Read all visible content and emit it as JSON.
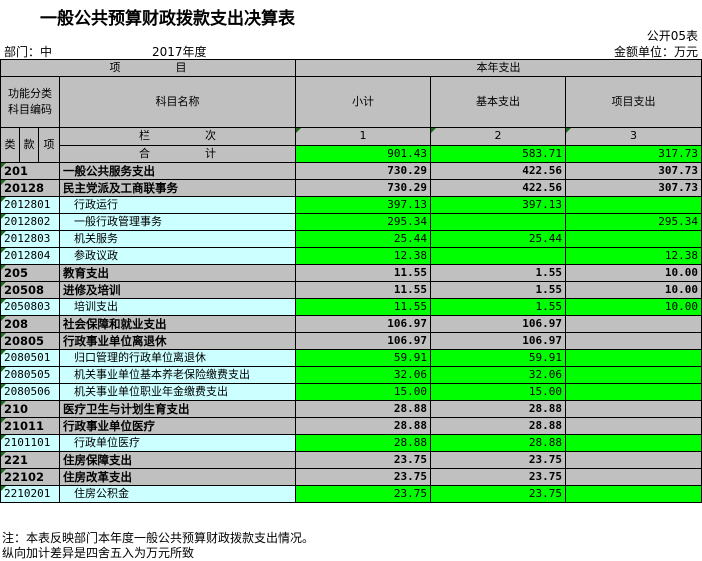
{
  "title": "一般公共预算财政拨款支出决算表",
  "form_no": "公开05表",
  "department_label": "部门：中",
  "year": "2017年度",
  "unit": "金额单位：万元",
  "header": {
    "item": "项　　　　　目",
    "this_year": "本年支出",
    "func_code": "功能分类\n科目编码",
    "subject_name": "科目名称",
    "subtotal": "小计",
    "basic": "基本支出",
    "project": "项目支出",
    "lei": "类",
    "kuan": "款",
    "xiang": "项",
    "column_label": "栏　　　　　次",
    "col1": "1",
    "col2": "2",
    "col3": "3",
    "total_label": "合　　　　　计"
  },
  "totals": {
    "subtotal": "901.43",
    "basic": "583.71",
    "project": "317.73"
  },
  "rows": [
    {
      "code": "201",
      "name": "一般公共服务支出",
      "subtotal": "730.29",
      "basic": "422.56",
      "project": "307.73",
      "level": 1
    },
    {
      "code": "20128",
      "name": "民主党派及工商联事务",
      "subtotal": "730.29",
      "basic": "422.56",
      "project": "307.73",
      "level": 2
    },
    {
      "code": "2012801",
      "name": "行政运行",
      "subtotal": "397.13",
      "basic": "397.13",
      "project": "",
      "level": 3
    },
    {
      "code": "2012802",
      "name": "一般行政管理事务",
      "subtotal": "295.34",
      "basic": "",
      "project": "295.34",
      "level": 3
    },
    {
      "code": "2012803",
      "name": "机关服务",
      "subtotal": "25.44",
      "basic": "25.44",
      "project": "",
      "level": 3
    },
    {
      "code": "2012804",
      "name": "参政议政",
      "subtotal": "12.38",
      "basic": "",
      "project": "12.38",
      "level": 3
    },
    {
      "code": "205",
      "name": "教育支出",
      "subtotal": "11.55",
      "basic": "1.55",
      "project": "10.00",
      "level": 1
    },
    {
      "code": "20508",
      "name": "进修及培训",
      "subtotal": "11.55",
      "basic": "1.55",
      "project": "10.00",
      "level": 2
    },
    {
      "code": "2050803",
      "name": "培训支出",
      "subtotal": "11.55",
      "basic": "1.55",
      "project": "10.00",
      "level": 3
    },
    {
      "code": "208",
      "name": "社会保障和就业支出",
      "subtotal": "106.97",
      "basic": "106.97",
      "project": "",
      "level": 1
    },
    {
      "code": "20805",
      "name": "行政事业单位离退休",
      "subtotal": "106.97",
      "basic": "106.97",
      "project": "",
      "level": 2
    },
    {
      "code": "2080501",
      "name": "归口管理的行政单位离退休",
      "subtotal": "59.91",
      "basic": "59.91",
      "project": "",
      "level": 3
    },
    {
      "code": "2080505",
      "name": "机关事业单位基本养老保险缴费支出",
      "subtotal": "32.06",
      "basic": "32.06",
      "project": "",
      "level": 3
    },
    {
      "code": "2080506",
      "name": "机关事业单位职业年金缴费支出",
      "subtotal": "15.00",
      "basic": "15.00",
      "project": "",
      "level": 3
    },
    {
      "code": "210",
      "name": "医疗卫生与计划生育支出",
      "subtotal": "28.88",
      "basic": "28.88",
      "project": "",
      "level": 1
    },
    {
      "code": "21011",
      "name": "行政事业单位医疗",
      "subtotal": "28.88",
      "basic": "28.88",
      "project": "",
      "level": 2
    },
    {
      "code": "2101101",
      "name": "行政单位医疗",
      "subtotal": "28.88",
      "basic": "28.88",
      "project": "",
      "level": 3
    },
    {
      "code": "221",
      "name": "住房保障支出",
      "subtotal": "23.75",
      "basic": "23.75",
      "project": "",
      "level": 1
    },
    {
      "code": "22102",
      "name": "住房改革支出",
      "subtotal": "23.75",
      "basic": "23.75",
      "project": "",
      "level": 2
    },
    {
      "code": "2210201",
      "name": "住房公积金",
      "subtotal": "23.75",
      "basic": "23.75",
      "project": "",
      "level": 3
    }
  ],
  "notes": [
    "注：本表反映部门本年度一般公共预算财政拨款支出情况。",
    "纵向加计差异是四舍五入为万元所致"
  ],
  "colors": {
    "green": "#00ff00",
    "cyan": "#ccffff",
    "gray": "#c0c0c0"
  }
}
